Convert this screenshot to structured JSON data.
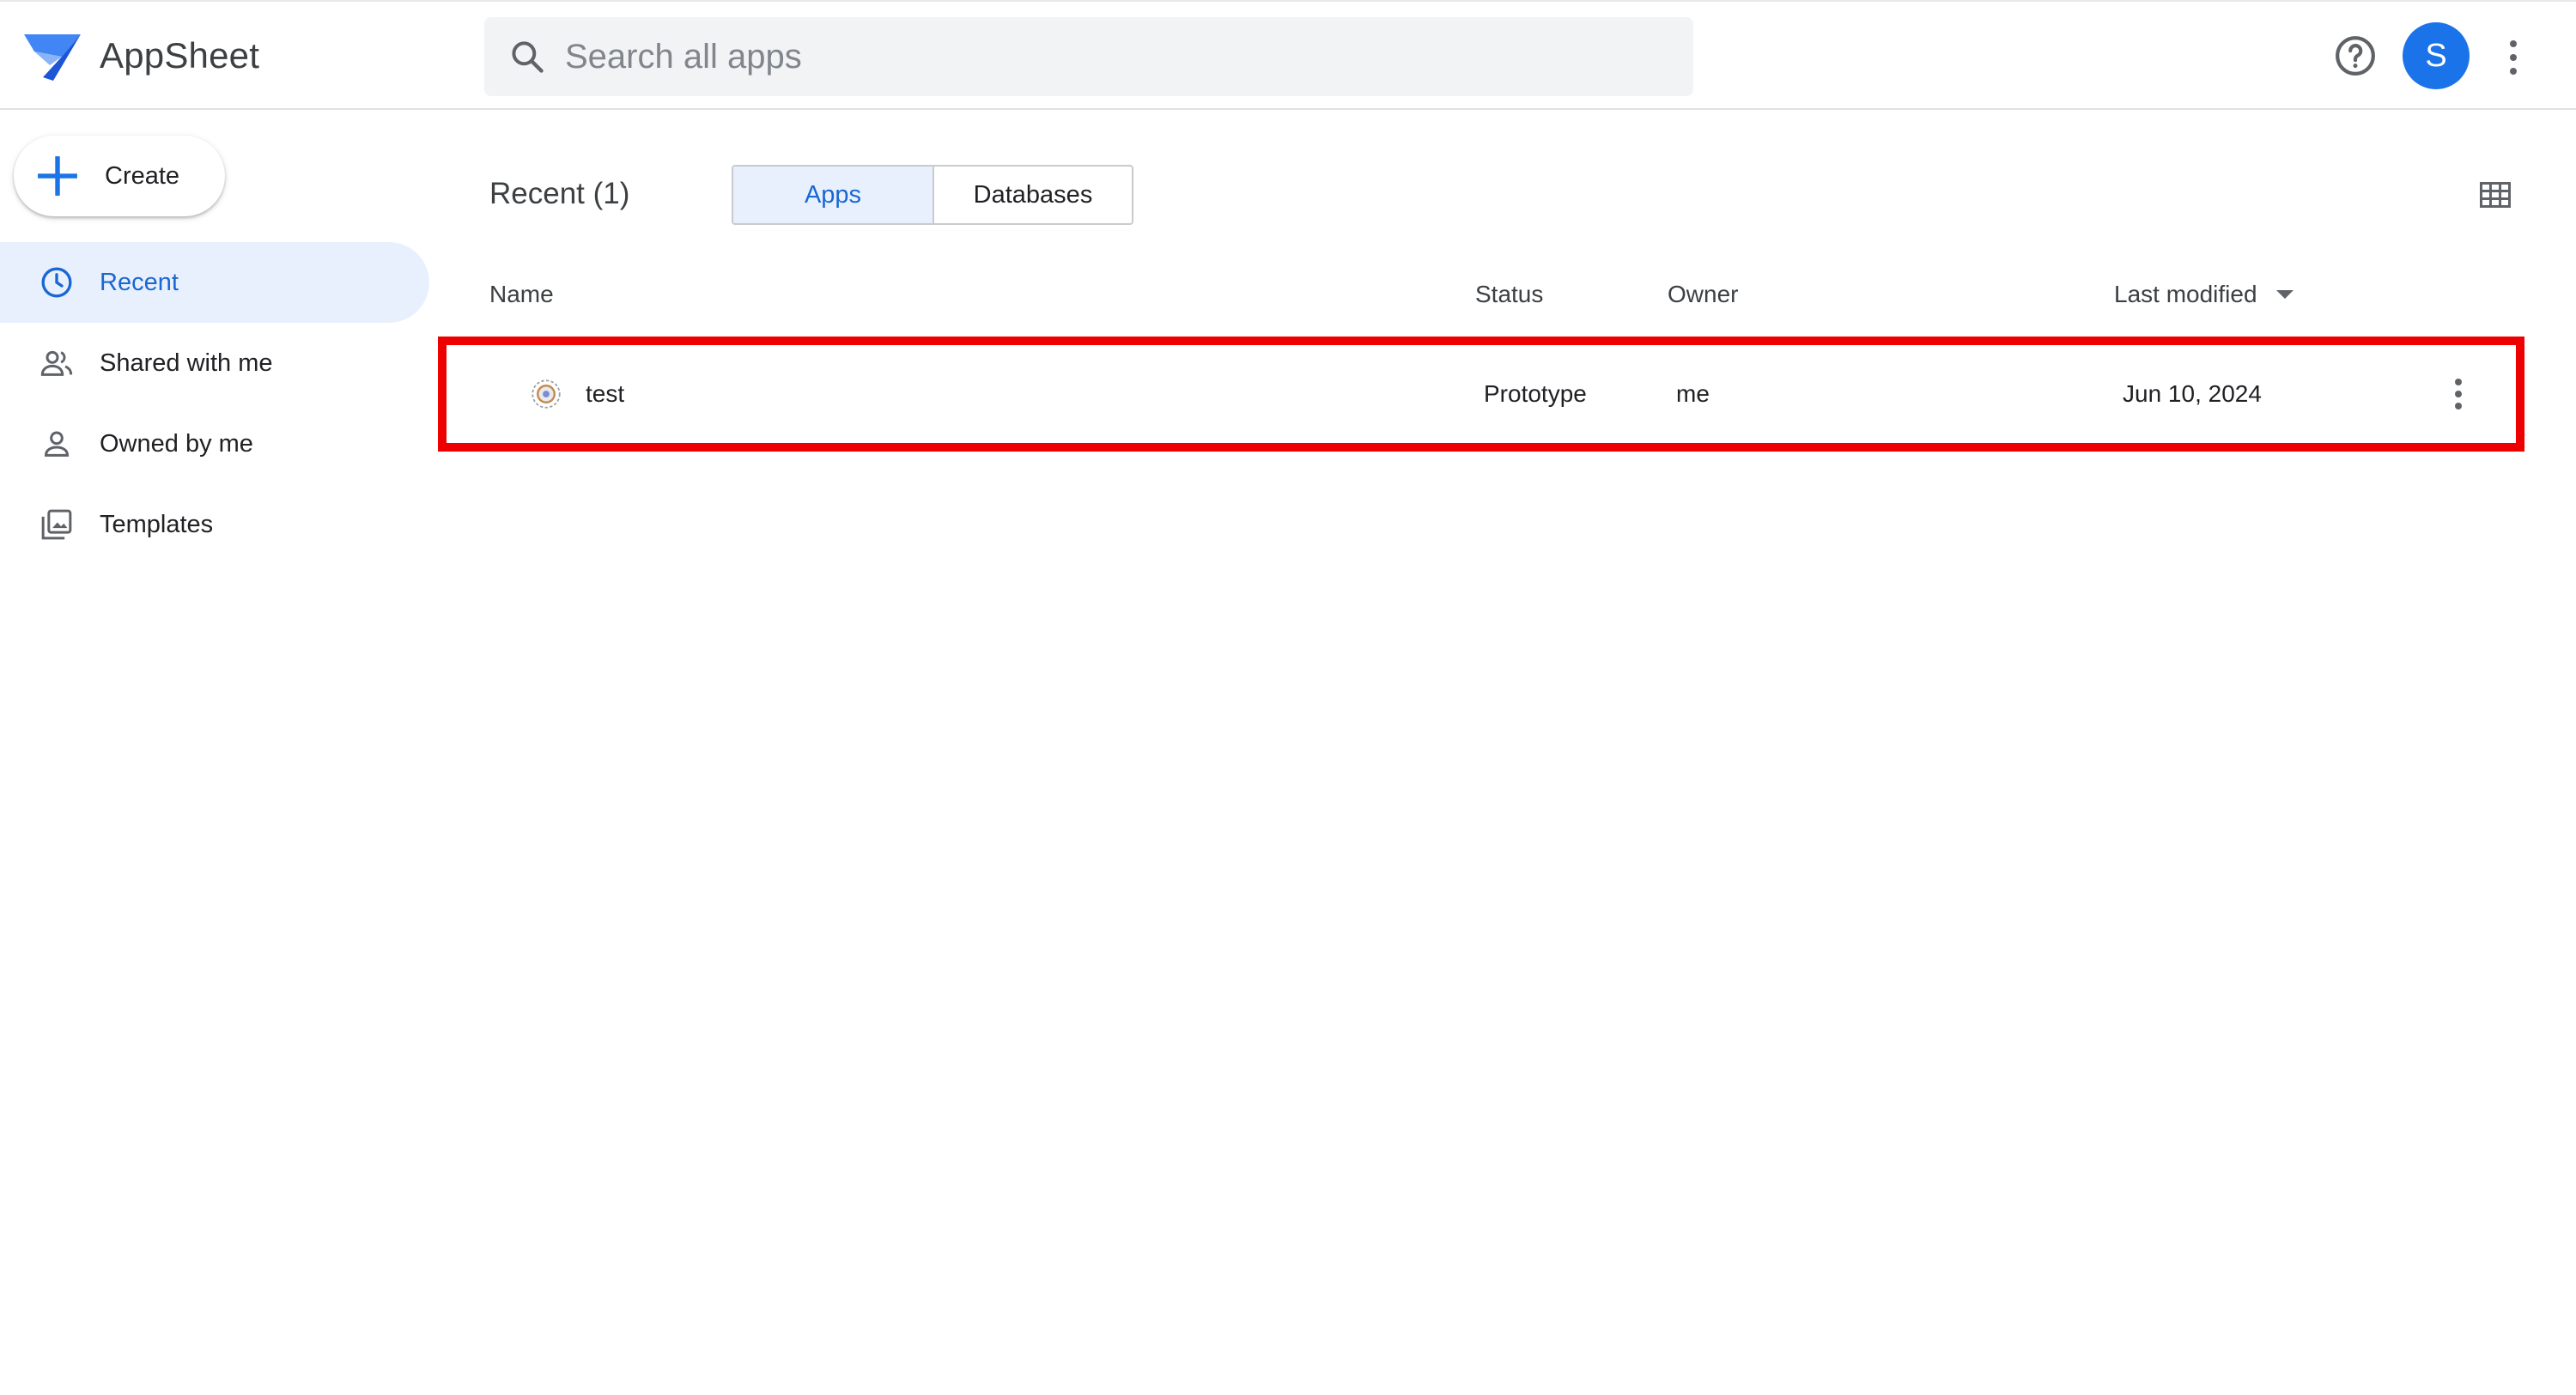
{
  "header": {
    "app_name": "AppSheet",
    "search_placeholder": "Search all apps",
    "avatar_initial": "S",
    "help_icon": "help-circle-icon",
    "more_icon": "more-vert-icon"
  },
  "sidebar": {
    "create_label": "Create",
    "items": [
      {
        "label": "Recent",
        "icon": "clock-icon",
        "active": true
      },
      {
        "label": "Shared with me",
        "icon": "people-icon",
        "active": false
      },
      {
        "label": "Owned by me",
        "icon": "person-icon",
        "active": false
      },
      {
        "label": "Templates",
        "icon": "templates-icon",
        "active": false
      }
    ]
  },
  "main": {
    "title": "Recent (1)",
    "tabs": [
      {
        "label": "Apps",
        "active": true
      },
      {
        "label": "Databases",
        "active": false
      }
    ],
    "view_toggle_icon": "grid-view-icon",
    "columns": {
      "name": "Name",
      "status": "Status",
      "owner": "Owner",
      "last_modified": "Last modified"
    },
    "rows": [
      {
        "name": "test",
        "status": "Prototype",
        "owner": "me",
        "last_modified": "Jun 10, 2024",
        "icon": "app-gear-icon"
      }
    ]
  },
  "colors": {
    "accent": "#1a73e8",
    "active_bg": "#e8f0fe",
    "highlight": "#ee0000"
  }
}
